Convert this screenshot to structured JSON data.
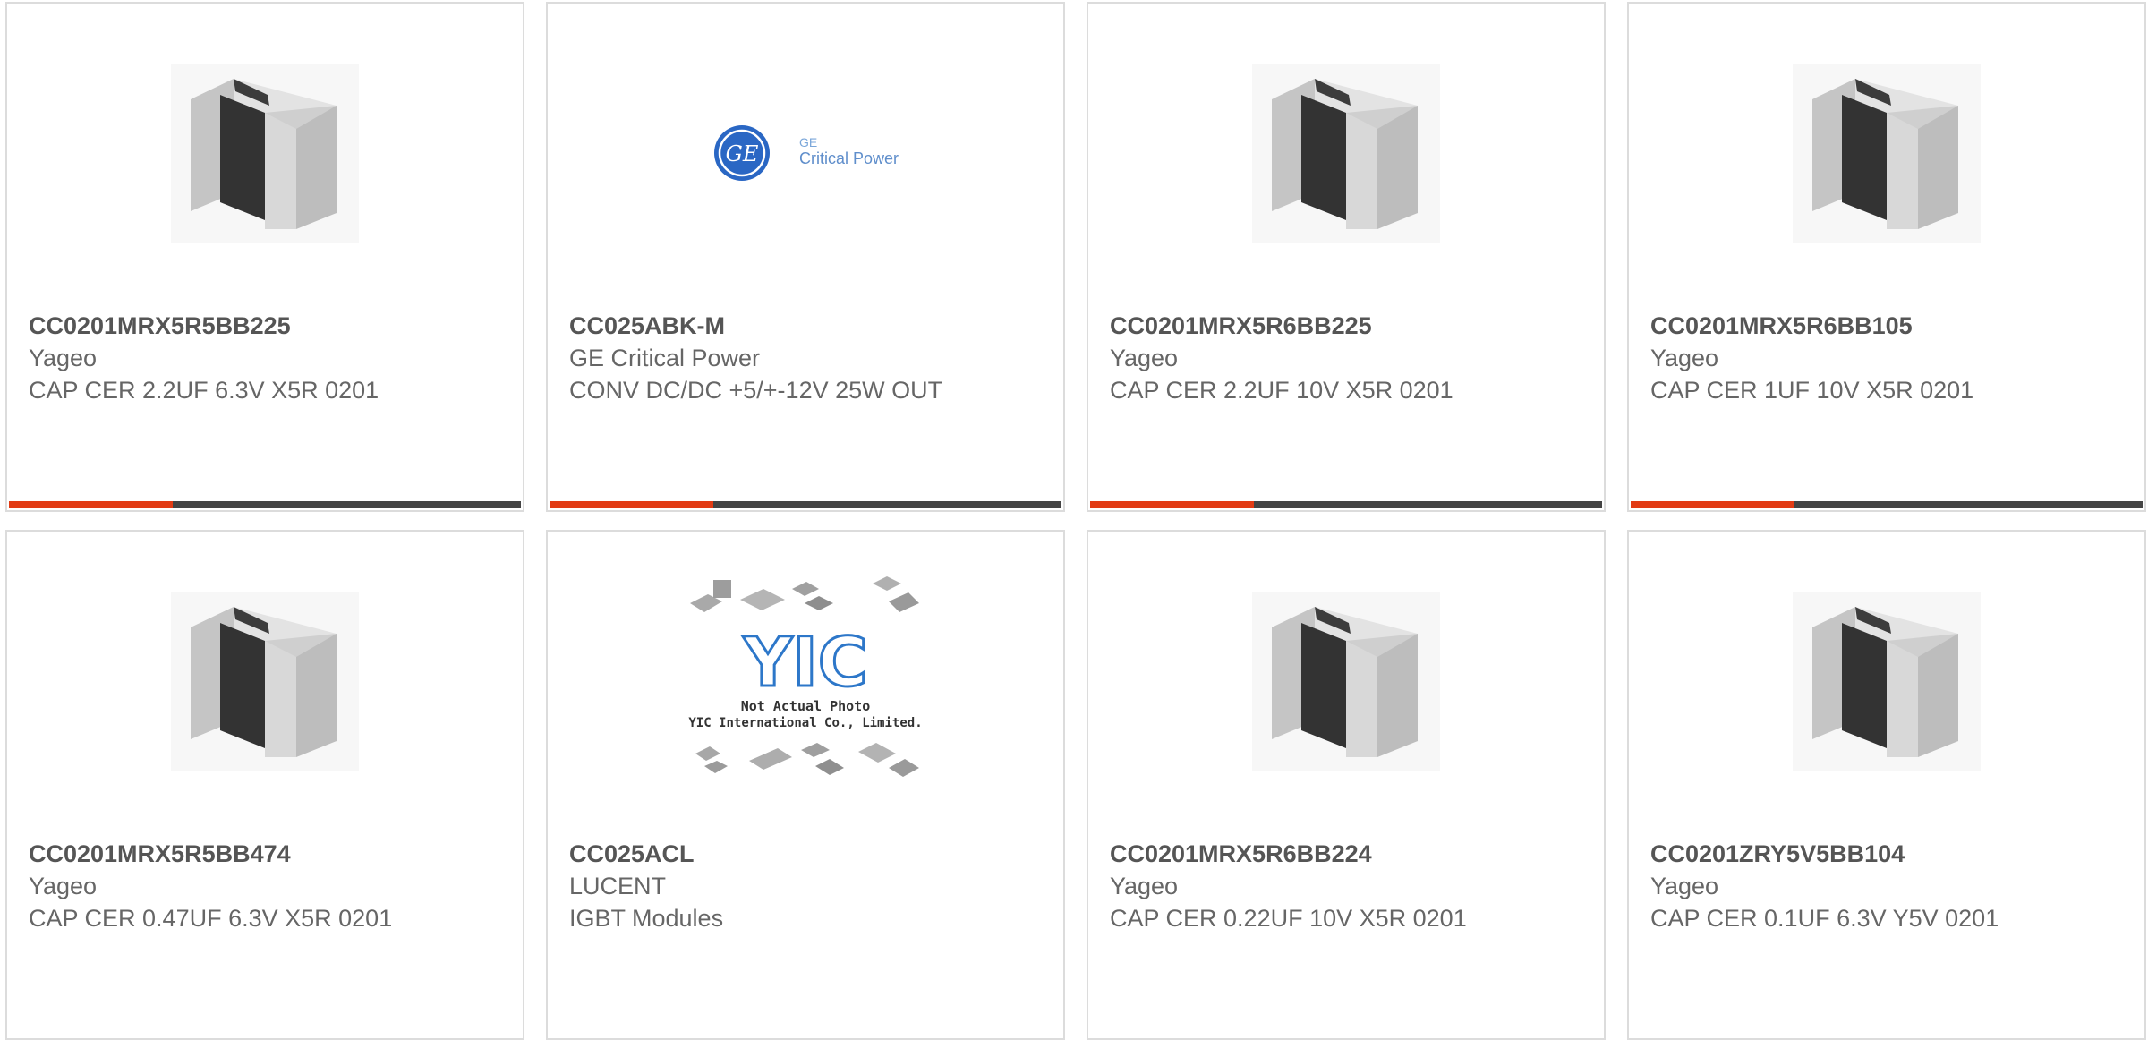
{
  "colors": {
    "accent": "#e23b14",
    "bar_track": "#444444",
    "border": "#dcdcdc"
  },
  "progress_fraction": 0.32,
  "cards": [
    {
      "part_number": "CC0201MRX5R5BB225",
      "manufacturer": "Yageo",
      "description": "CAP CER 2.2UF 6.3V X5R 0201",
      "image": "capacitor-chip-image"
    },
    {
      "part_number": "CC025ABK-M",
      "manufacturer": "GE Critical Power",
      "description": "CONV DC/DC +5/+-12V 25W OUT",
      "image": "ge-critical-power-logo",
      "logo": {
        "monogram": "GE",
        "line1": "GE",
        "line2": "Critical Power"
      }
    },
    {
      "part_number": "CC0201MRX5R6BB225",
      "manufacturer": "Yageo",
      "description": "CAP CER 2.2UF 10V X5R 0201",
      "image": "capacitor-chip-image"
    },
    {
      "part_number": "CC0201MRX5R6BB105",
      "manufacturer": "Yageo",
      "description": "CAP CER 1UF 10V X5R 0201",
      "image": "capacitor-chip-image"
    },
    {
      "part_number": "CC0201MRX5R5BB474",
      "manufacturer": "Yageo",
      "description": "CAP CER 0.47UF 6.3V X5R 0201",
      "image": "capacitor-chip-image"
    },
    {
      "part_number": "CC025ACL",
      "manufacturer": "LUCENT",
      "description": "IGBT Modules",
      "image": "yic-placeholder-image",
      "placeholder": {
        "logo": "YIC",
        "line1": "Not Actual Photo",
        "line2": "YIC International Co., Limited."
      }
    },
    {
      "part_number": "CC0201MRX5R6BB224",
      "manufacturer": "Yageo",
      "description": "CAP CER 0.22UF 10V X5R 0201",
      "image": "capacitor-chip-image"
    },
    {
      "part_number": "CC0201ZRY5V5BB104",
      "manufacturer": "Yageo",
      "description": "CAP CER 0.1UF 6.3V Y5V 0201",
      "image": "capacitor-chip-image"
    }
  ]
}
